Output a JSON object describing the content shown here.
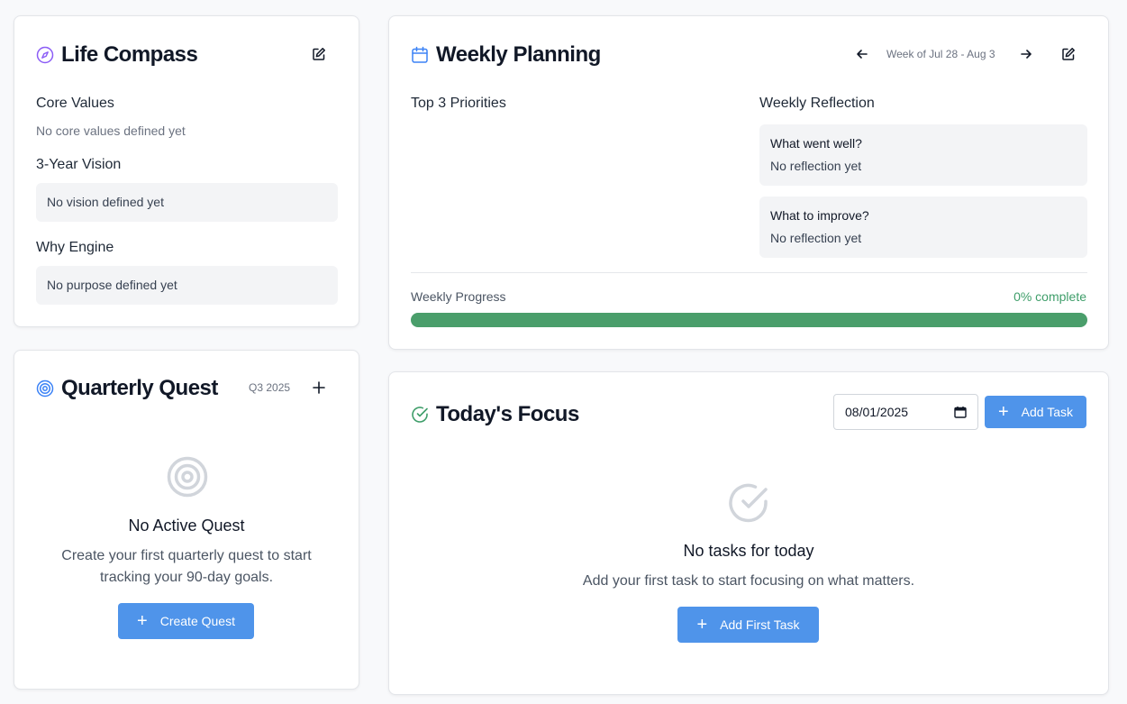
{
  "life_compass": {
    "title": "Life Compass",
    "core_values": {
      "label": "Core Values",
      "empty": "No core values defined yet"
    },
    "vision": {
      "label": "3-Year Vision",
      "empty": "No vision defined yet"
    },
    "why_engine": {
      "label": "Why Engine",
      "empty": "No purpose defined yet"
    }
  },
  "quarterly_quest": {
    "title": "Quarterly Quest",
    "quarter": "Q3 2025",
    "empty_title": "No Active Quest",
    "empty_description_line1": "Create your first quarterly quest to start",
    "empty_description_line2": "tracking your 90-day goals.",
    "create_button": "Create Quest"
  },
  "weekly_planning": {
    "title": "Weekly Planning",
    "week_range": "Week of Jul 28 - Aug 3",
    "priorities_label": "Top 3 Priorities",
    "reflection_label": "Weekly Reflection",
    "went_well": {
      "label": "What went well?",
      "value": "No reflection yet"
    },
    "to_improve": {
      "label": "What to improve?",
      "value": "No reflection yet"
    },
    "progress_label": "Weekly Progress",
    "progress_text": "0% complete",
    "progress_percent": 0
  },
  "todays_focus": {
    "title": "Today's Focus",
    "date_value": "2025-08-01",
    "date_display": "08/01/2025",
    "add_task_button": "Add Task",
    "empty_title": "No tasks for today",
    "empty_description": "Add your first task to start focusing on what matters.",
    "add_first_task_button": "Add First Task"
  },
  "colors": {
    "primary_blue": "#4f94ea",
    "progress_green": "#4a9e6b",
    "compass_purple": "#8b5cf6",
    "focus_green": "#3f9e6a"
  }
}
